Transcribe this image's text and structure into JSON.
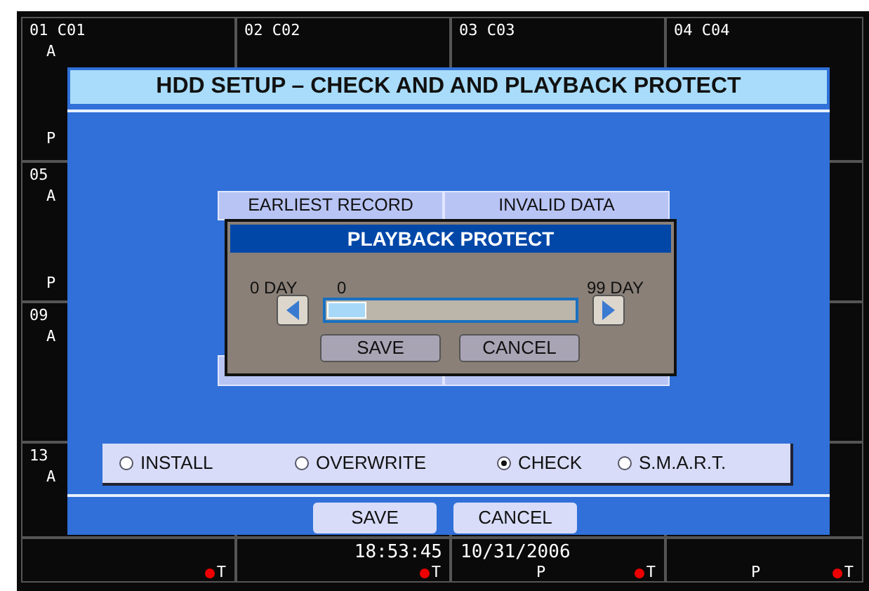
{
  "channels": [
    {
      "label": "01 C01",
      "marks": [
        "A",
        "P"
      ]
    },
    {
      "label": "02 C02"
    },
    {
      "label": "03 C03"
    },
    {
      "label": "04 C04"
    },
    {
      "label": "05",
      "marks": [
        "A",
        "P"
      ]
    },
    {
      "label": "09",
      "marks": [
        "A"
      ]
    },
    {
      "label": "13",
      "marks": [
        "A"
      ]
    }
  ],
  "status_cells": [
    {
      "record_mark": "T"
    },
    {
      "time": "18:53:45",
      "record_mark": "T"
    },
    {
      "date": "10/31/2006",
      "mode": "P",
      "record_mark": "T"
    },
    {
      "mode": "P",
      "record_mark": "T"
    }
  ],
  "dialog": {
    "title": "HDD SETUP – CHECK AND  AND PLAYBACK PROTECT",
    "table_headers": [
      "EARLIEST RECORD",
      "INVALID DATA"
    ],
    "modes": [
      {
        "label": "INSTALL",
        "selected": false
      },
      {
        "label": "OVERWRITE",
        "selected": false
      },
      {
        "label": "CHECK",
        "selected": true
      },
      {
        "label": "S.M.A.R.T.",
        "selected": false
      }
    ],
    "buttons": [
      "SAVE",
      "CANCEL"
    ]
  },
  "popup": {
    "title": "PLAYBACK PROTECT",
    "min_label": "0 DAY",
    "value": "0",
    "max_label": "99 DAY",
    "level": 0,
    "buttons": [
      "SAVE",
      "CANCEL"
    ]
  }
}
